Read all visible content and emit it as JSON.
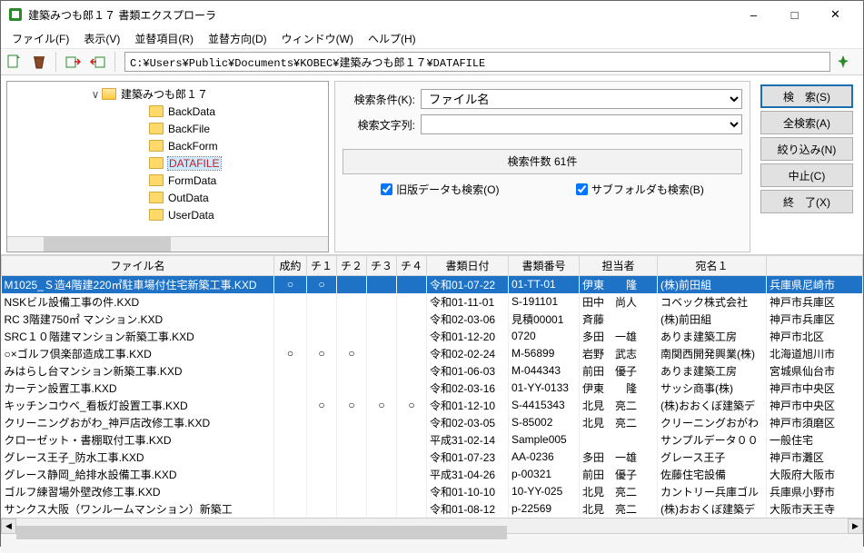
{
  "window": {
    "title": "建築みつも郎１７ 書類エクスプローラ"
  },
  "menu": {
    "file": "ファイル(F)",
    "view": "表示(V)",
    "sortitem": "並替項目(R)",
    "sortdir": "並替方向(D)",
    "window": "ウィンドウ(W)",
    "help": "ヘルプ(H)"
  },
  "path": "C:¥Users¥Public¥Documents¥KOBEC¥建築みつも郎１７¥DATAFILE",
  "tree": {
    "root": "建築みつも郎１７",
    "children": [
      "BackData",
      "BackFile",
      "BackForm",
      "DATAFILE",
      "FormData",
      "OutData",
      "UserData"
    ]
  },
  "search": {
    "cond_label": "検索条件(K):",
    "cond_value": "ファイル名",
    "text_label": "検索文字列:",
    "text_value": "",
    "result": "検索件数 61件",
    "chk_old": "旧版データも検索(O)",
    "chk_sub": "サブフォルダも検索(B)"
  },
  "buttons": {
    "search": "検　索(S)",
    "all": "全検索(A)",
    "narrow": "絞り込み(N)",
    "stop": "中止(C)",
    "close": "終　了(X)"
  },
  "grid": {
    "headers": {
      "name": "ファイル名",
      "k": "成約",
      "c1": "チ１",
      "c2": "チ２",
      "c3": "チ３",
      "c4": "チ４",
      "date": "書類日付",
      "num": "書類番号",
      "own": "担当者",
      "ad": "宛名１"
    },
    "rows": [
      {
        "sel": true,
        "name": "M1025_Ｓ造4階建220㎡駐車場付住宅新築工事.KXD",
        "k": "○",
        "c1": "○",
        "date": "令和01-07-22",
        "num": "01-TT-01",
        "own": "伊東　　隆",
        "ad": "(株)前田組",
        "addr": "兵庫県尼崎市"
      },
      {
        "name": "NSKビル設備工事の件.KXD",
        "date": "令和01-11-01",
        "num": "S-191101",
        "own": "田中　尚人",
        "ad": "コベック株式会社",
        "addr": "神戸市兵庫区"
      },
      {
        "name": "RC 3階建750㎡ マンション.KXD",
        "date": "令和02-03-06",
        "num": "見積00001",
        "own": "斉藤",
        "ad": "(株)前田組",
        "addr": "神戸市兵庫区"
      },
      {
        "name": "SRC１０階建マンション新築工事.KXD",
        "date": "令和01-12-20",
        "num": "0720",
        "own": "多田　一雄",
        "ad": "ありま建築工房",
        "addr": "神戸市北区"
      },
      {
        "name": "○×ゴルフ倶楽部造成工事.KXD",
        "k": "○",
        "c1": "○",
        "c2": "○",
        "date": "令和02-02-24",
        "num": "M-56899",
        "own": "岩野　武志",
        "ad": "南関西開発興業(株)",
        "addr": "北海道旭川市"
      },
      {
        "name": "みはらし台マンション新築工事.KXD",
        "date": "令和01-06-03",
        "num": "M-044343",
        "own": "前田　優子",
        "ad": "ありま建築工房",
        "addr": "宮城県仙台市"
      },
      {
        "name": "カーテン設置工事.KXD",
        "date": "令和02-03-16",
        "num": "01-YY-0133",
        "own": "伊東　　隆",
        "ad": "サッシ商事(株)",
        "addr": "神戸市中央区"
      },
      {
        "name": "キッチンコウベ_看板灯設置工事.KXD",
        "c1": "○",
        "c2": "○",
        "c3": "○",
        "c4": "○",
        "date": "令和01-12-10",
        "num": "S-4415343",
        "own": "北見　亮二",
        "ad": "(株)おおくぼ建築デ",
        "addr": "神戸市中央区"
      },
      {
        "name": "クリーニングおがわ_神戸店改修工事.KXD",
        "date": "令和02-03-05",
        "num": "S-85002",
        "own": "北見　亮二",
        "ad": "クリーニングおがわ",
        "addr": "神戸市須磨区"
      },
      {
        "name": "クローゼット・書棚取付工事.KXD",
        "date": "平成31-02-14",
        "num": "Sample005",
        "ad": "サンプルデータ００",
        "addr": "一般住宅"
      },
      {
        "name": "グレース王子_防水工事.KXD",
        "date": "令和01-07-23",
        "num": "AA-0236",
        "own": "多田　一雄",
        "ad": "グレース王子",
        "addr": "神戸市灘区"
      },
      {
        "name": "グレース静岡_給排水設備工事.KXD",
        "date": "平成31-04-26",
        "num": "p-00321",
        "own": "前田　優子",
        "ad": "佐藤住宅設備",
        "addr": "大阪府大阪市"
      },
      {
        "name": "ゴルフ練習場外壁改修工事.KXD",
        "date": "令和01-10-10",
        "num": "10-YY-025",
        "own": "北見　亮二",
        "ad": "カントリー兵庫ゴル",
        "addr": "兵庫県小野市"
      },
      {
        "name": "サンクス大阪（ワンルームマンション）新築工",
        "date": "令和01-08-12",
        "num": "p-22569",
        "own": "北見　亮二",
        "ad": "(株)おおくぼ建築デ",
        "addr": "大阪市天王寺"
      }
    ]
  }
}
